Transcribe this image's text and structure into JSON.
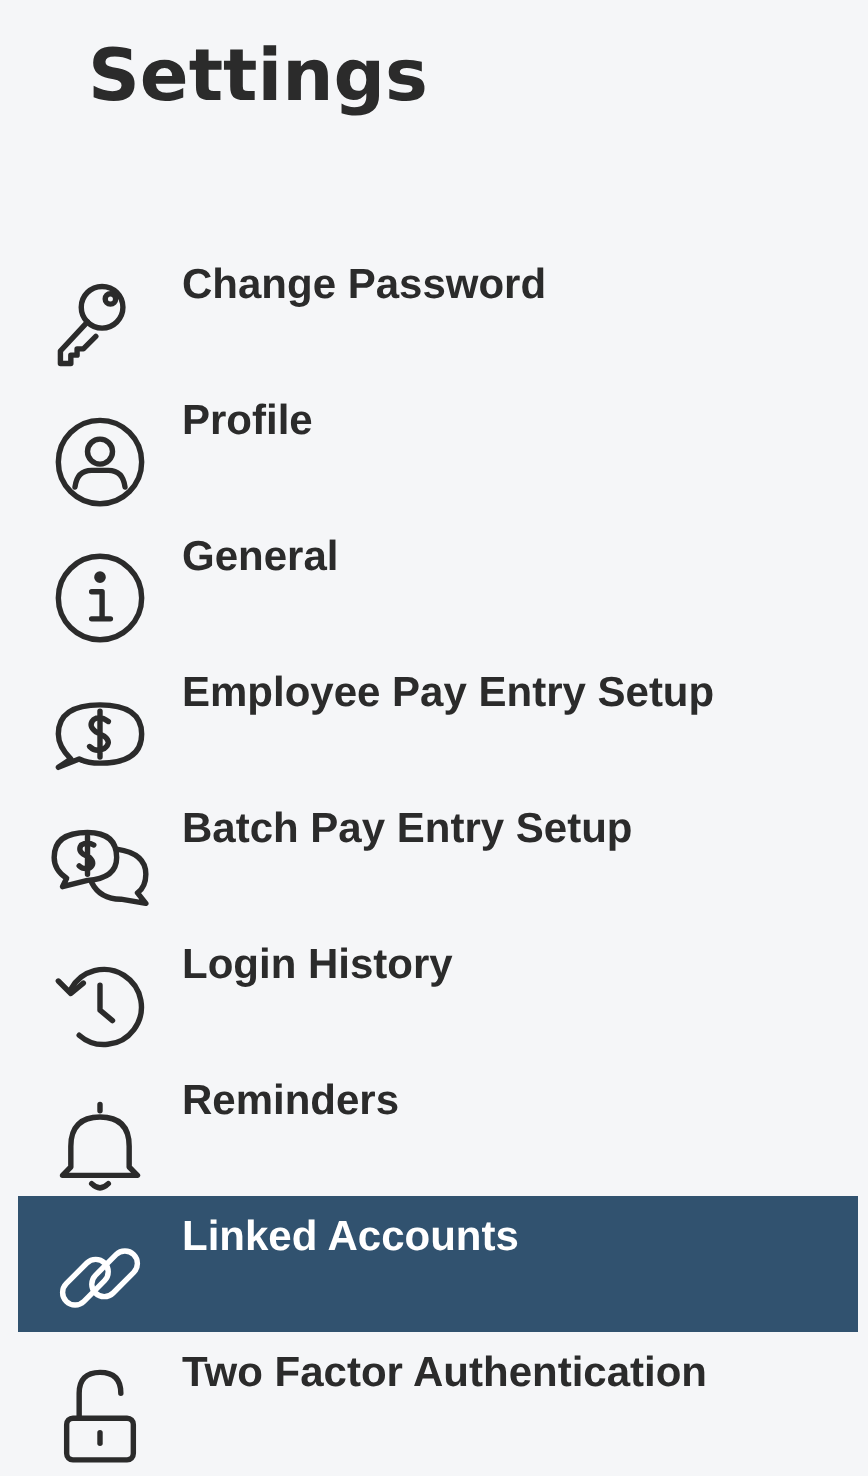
{
  "title": "Settings",
  "items": [
    {
      "label": "Change Password",
      "selected": false
    },
    {
      "label": "Profile",
      "selected": false
    },
    {
      "label": "General",
      "selected": false
    },
    {
      "label": "Employee Pay Entry Setup",
      "selected": false
    },
    {
      "label": "Batch Pay Entry Setup",
      "selected": false
    },
    {
      "label": "Login History",
      "selected": false
    },
    {
      "label": "Reminders",
      "selected": false
    },
    {
      "label": "Linked Accounts",
      "selected": true
    },
    {
      "label": "Two Factor Authentication",
      "selected": false
    }
  ]
}
